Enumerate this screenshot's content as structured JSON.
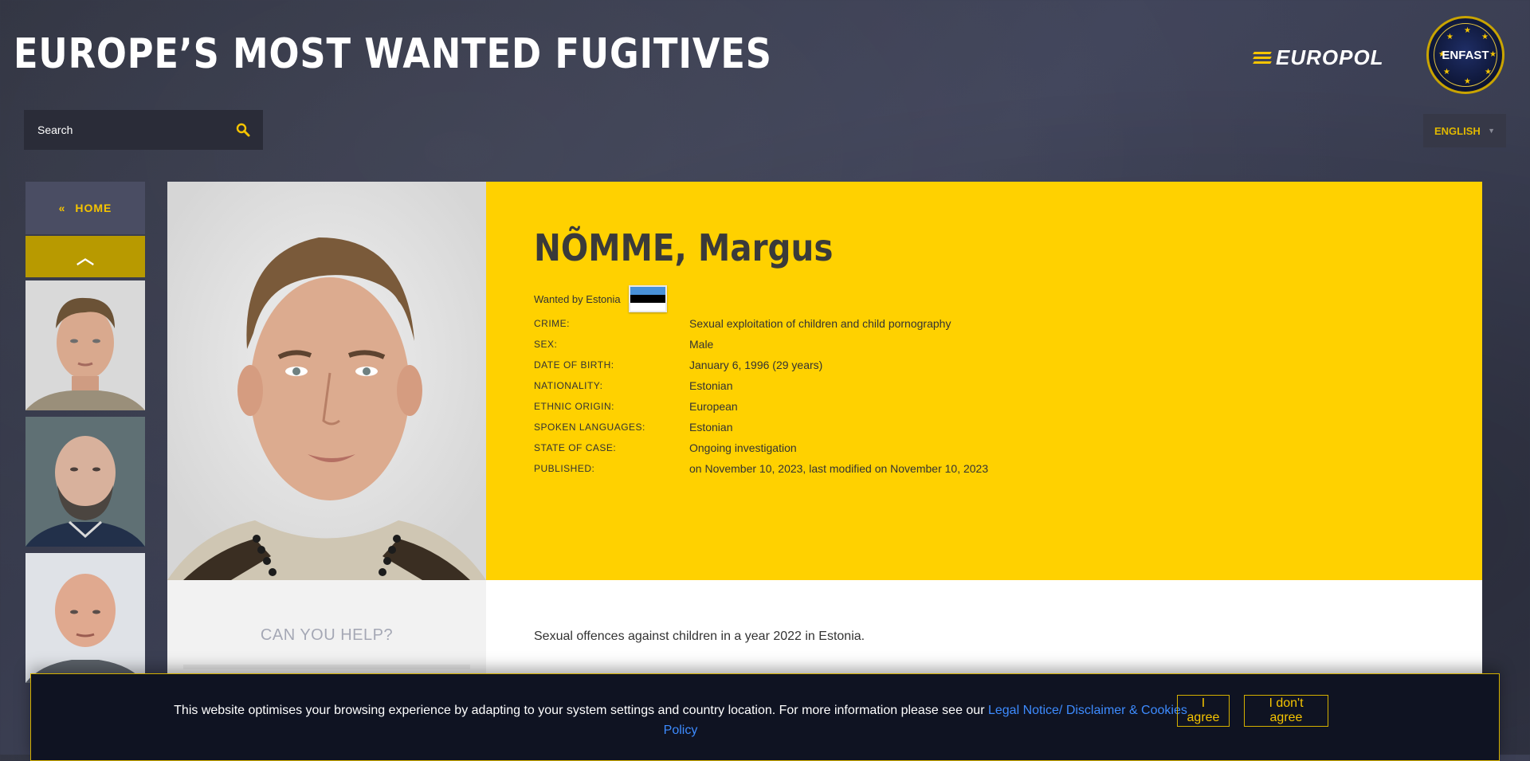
{
  "header": {
    "title": "EUROPE’S MOST WANTED FUGITIVES",
    "europol_logo_text": "EUROPOL",
    "enfast_logo_text": "ENFAST"
  },
  "search": {
    "placeholder": "Search",
    "icon": "search-icon"
  },
  "language": {
    "selected": "ENGLISH"
  },
  "sidebar": {
    "home_label": "HOME",
    "home_icon": "double-chevron-left-icon",
    "up_icon": "chevron-up-icon"
  },
  "profile": {
    "name": "NÕMME, Margus",
    "wanted_by": "Wanted by Estonia",
    "flag_colors": [
      "#4891d9",
      "#000000",
      "#ffffff"
    ],
    "facts": [
      {
        "label": "CRIME:",
        "value": "Sexual exploitation of children and child pornography"
      },
      {
        "label": "SEX:",
        "value": "Male"
      },
      {
        "label": "DATE OF BIRTH:",
        "value": "January 6, 1996 (29 years)"
      },
      {
        "label": "NATIONALITY:",
        "value": "Estonian"
      },
      {
        "label": "ETHNIC ORIGIN:",
        "value": "European"
      },
      {
        "label": "SPOKEN LANGUAGES:",
        "value": "Estonian"
      },
      {
        "label": "STATE OF CASE:",
        "value": "Ongoing investigation"
      },
      {
        "label": "PUBLISHED:",
        "value": "on November 10, 2023, last modified on November 10, 2023"
      }
    ],
    "description": "Sexual offences against children in a year 2022 in Estonia."
  },
  "help": {
    "title": "CAN YOU HELP?"
  },
  "cookie": {
    "text": "This website optimises your browsing experience by adapting to your system settings and country location. For more information please see our ",
    "link_text": "Legal Notice/ Disclaimer & Cookies Policy",
    "agree": "I agree",
    "disagree": "I don't agree"
  },
  "colors": {
    "accent": "#ffd100",
    "button_border": "#d4b000",
    "link": "#3d8bff"
  }
}
